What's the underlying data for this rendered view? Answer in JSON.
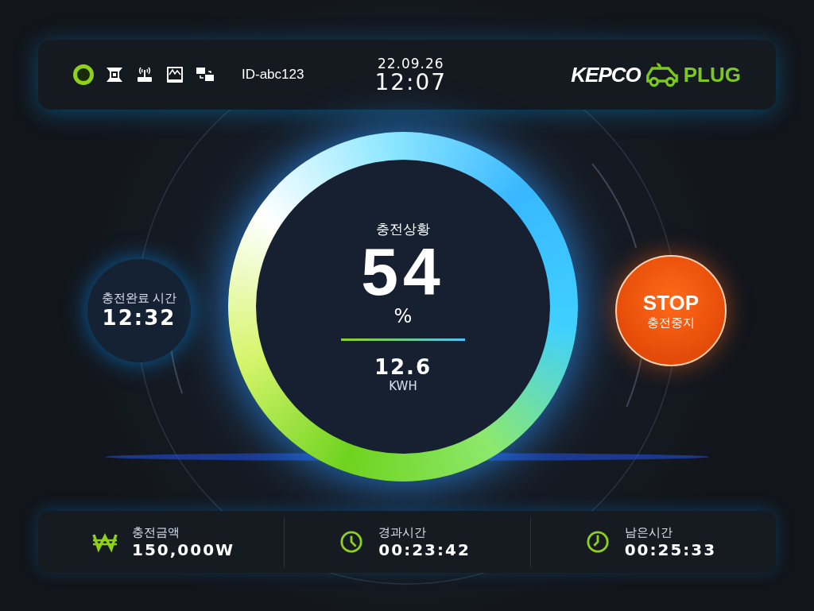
{
  "status_bar": {
    "power_on": true,
    "device_id": "ID-abc123",
    "date": "22.09.26",
    "time": "12:07",
    "logo": {
      "left": "KEPCO",
      "right": "PLUG"
    }
  },
  "charge": {
    "title": "충전상황",
    "percent": "54",
    "unit": "%",
    "energy": "12.6",
    "energy_unit": "KWH"
  },
  "completion": {
    "label": "충전완료 시간",
    "time": "12:32"
  },
  "stop_button": {
    "label": "STOP",
    "sublabel": "충전중지"
  },
  "stats": [
    {
      "kind": "won",
      "label": "충전금액",
      "value": "150,000W"
    },
    {
      "kind": "clock",
      "label": "경과시간",
      "value": "00:23:42"
    },
    {
      "kind": "timer",
      "label": "남은시간",
      "value": "00:25:33"
    }
  ]
}
